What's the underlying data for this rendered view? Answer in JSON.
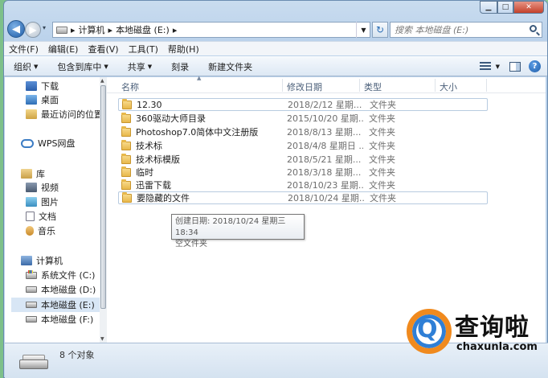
{
  "address": {
    "crumbs": [
      "计算机",
      "本地磁盘 (E:)"
    ],
    "search_placeholder": "搜索 本地磁盘 (E:)"
  },
  "menu": [
    "文件(F)",
    "编辑(E)",
    "查看(V)",
    "工具(T)",
    "帮助(H)"
  ],
  "commands": {
    "organize": "组织",
    "include_library": "包含到库中",
    "share": "共享",
    "burn": "刻录",
    "new_folder": "新建文件夹"
  },
  "nav": {
    "favorites": [
      "下载",
      "桌面",
      "最近访问的位置"
    ],
    "wps": "WPS网盘",
    "library": "库",
    "library_items": [
      "视频",
      "图片",
      "文档",
      "音乐"
    ],
    "computer": "计算机",
    "drives": [
      "系统文件 (C:)",
      "本地磁盘 (D:)",
      "本地磁盘 (E:)",
      "本地磁盘 (F:)"
    ],
    "selected_drive_index": 2
  },
  "columns": {
    "name": "名称",
    "modified": "修改日期",
    "type": "类型",
    "size": "大小"
  },
  "files": [
    {
      "name": "12.30",
      "modified": "2018/2/12 星期...",
      "type": "文件夹"
    },
    {
      "name": "360驱动大师目录",
      "modified": "2015/10/20 星期...",
      "type": "文件夹"
    },
    {
      "name": "Photoshop7.0简体中文注册版",
      "modified": "2018/8/13 星期...",
      "type": "文件夹"
    },
    {
      "name": "技术标",
      "modified": "2018/4/8 星期日 ...",
      "type": "文件夹"
    },
    {
      "name": "技术标模版",
      "modified": "2018/5/21 星期...",
      "type": "文件夹"
    },
    {
      "name": "临时",
      "modified": "2018/3/18 星期...",
      "type": "文件夹"
    },
    {
      "name": "迅雷下载",
      "modified": "2018/10/23 星期...",
      "type": "文件夹"
    },
    {
      "name": "要隐藏的文件",
      "modified": "2018/10/24 星期...",
      "type": "文件夹"
    }
  ],
  "tooltip": {
    "line1": "创建日期: 2018/10/24 星期三 18:34",
    "line2": "空文件夹"
  },
  "status": {
    "count": "8 个对象"
  },
  "watermark": {
    "title": "查询啦",
    "subtitle": "chaxunla.com",
    "glyph": "Q"
  },
  "colors": {
    "folder": "#e8b84a",
    "selection": "#d8e6f5",
    "accent": "#2f7fd6",
    "brand_orange": "#f08a1e"
  }
}
